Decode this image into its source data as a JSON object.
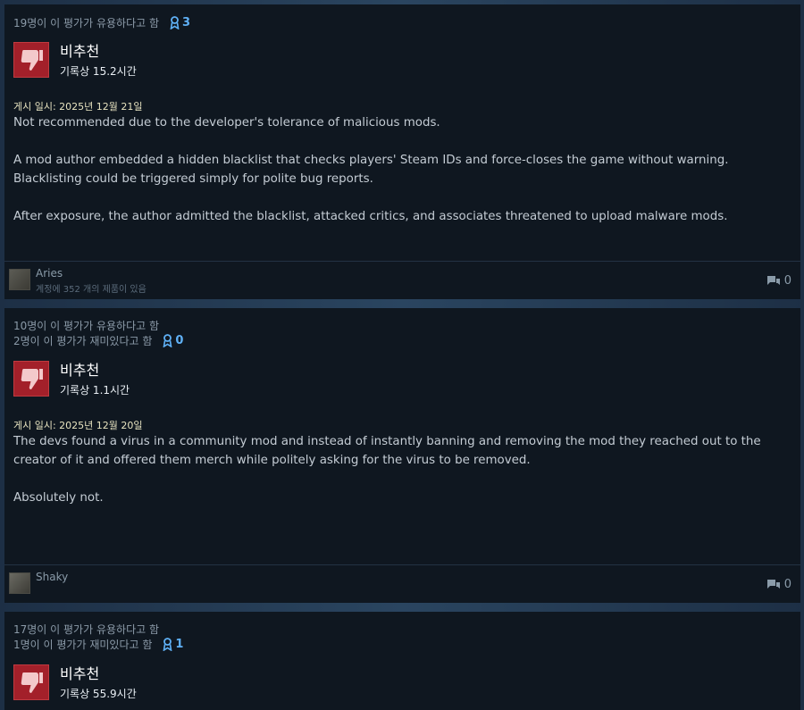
{
  "reviews": [
    {
      "helpful": "19명이 이 평가가 유용하다고 함",
      "funny": "",
      "awards": "3",
      "verdict": "비추천",
      "hours": "기록상 15.2시간",
      "posted": "게시 일시: 2025년 12월 21일",
      "paragraphs": [
        "Not recommended due to the developer's tolerance of malicious mods.",
        "A mod author embedded a hidden blacklist that checks players' Steam IDs and force-closes the game without warning. Blacklisting could be triggered simply for polite bug reports.",
        "After exposure, the author admitted the blacklist, attacked critics, and associates threatened to upload malware mods."
      ],
      "author": "Aries",
      "author_games": "계정에 352 개의 제품이 있음",
      "comments": "0"
    },
    {
      "helpful": "10명이 이 평가가 유용하다고 함",
      "funny": "2명이 이 평가가 재미있다고 함",
      "awards": "0",
      "verdict": "비추천",
      "hours": "기록상 1.1시간",
      "posted": "게시 일시: 2025년 12월 20일",
      "paragraphs": [
        "The devs found a virus in a community mod and instead of instantly banning and removing the mod they reached out to the creator of it and offered them merch while politely asking for the virus to be removed.",
        "Absolutely not."
      ],
      "author": "Shaky",
      "author_games": "",
      "comments": "0"
    },
    {
      "helpful": "17명이 이 평가가 유용하다고 함",
      "funny": "1명이 이 평가가 재미있다고 함",
      "awards": "1",
      "verdict": "비추천",
      "hours": "기록상 55.9시간"
    }
  ],
  "colors": {
    "thumb_bg": "#a3202a",
    "award": "#5fb0f5",
    "card_bg": "#0f1720"
  },
  "icons": {
    "thumbs_down": "thumbs-down-icon",
    "award": "award-ribbon-icon",
    "comment": "comment-bubble-icon"
  }
}
